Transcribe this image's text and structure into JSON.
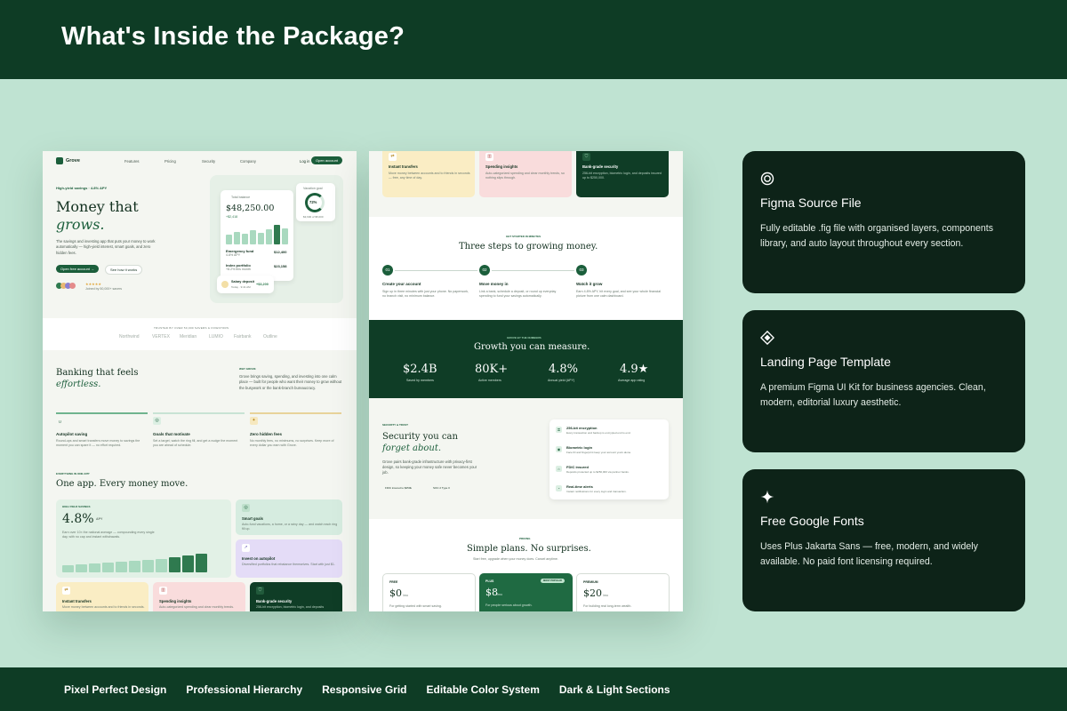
{
  "header": {
    "title": "What's Inside the Package?"
  },
  "footer": {
    "features": [
      "Pixel Perfect Design",
      "Professional Hierarchy",
      "Responsive Grid",
      "Editable Color System",
      "Dark & Light Sections"
    ]
  },
  "cards": [
    {
      "icon": "concentric-circles-icon",
      "title": "Figma Source File",
      "description": "Fully editable .fig file with organised layers, components library, and auto layout throughout every section."
    },
    {
      "icon": "diamond-icon",
      "title": "Landing Page Template",
      "description": "A premium Figma UI Kit for business agencies. Clean, modern, editorial luxury aesthetic."
    },
    {
      "icon": "sparkle-icon",
      "title": "Free Google Fonts",
      "description": "Uses Plus Jakarta Sans — free, modern, and widely available. No paid font licensing required."
    }
  ],
  "preview1": {
    "brand": "Grove",
    "nav": [
      "Features",
      "Pricing",
      "Security",
      "Company"
    ],
    "login": "Log in",
    "open_account": "Open account",
    "badge": "High-yield savings · 4.8% APY",
    "hero_title": "Money that",
    "hero_title_italic": "grows.",
    "hero_body": "The savings and investing app that puts your money to work automatically — high-yield interest, smart goals, and zero hidden fees.",
    "cta_primary": "Open free account →",
    "cta_secondary": "See how it works",
    "stars": "★★★★★",
    "savers": "Joined by 50,000+ savers",
    "balance_label": "Total balance",
    "balance": "$48,250.00",
    "balance_change": "+$2,418",
    "vacation_label": "Vacation goal",
    "vacation_pct": "72%",
    "vacation_amount": "$3,600 of $5,000",
    "accounts": [
      {
        "name": "Emergency fund",
        "sub": "4.8% APY",
        "amount": "$12,400"
      },
      {
        "name": "Index portfolio",
        "sub": "+8.2% this month",
        "amount": "$23,158"
      }
    ],
    "salary_label": "Salary deposit",
    "salary_sub": "Today · 9:41 AM",
    "salary_amount": "+$3,200",
    "trusted_label": "TRUSTED BY OVER 50,000 SAVERS & INVESTORS",
    "trusted": [
      "Northwind",
      "VERTEX",
      "Meridian",
      "LUMIO",
      "Fairbank",
      "Outline"
    ],
    "banking_title": "Banking that feels",
    "banking_italic": "effortless.",
    "why_label": "WHY GROVE",
    "why_body": "Grove brings saving, spending, and investing into one calm place — built for people who want their money to grow without the busywork or the bank-branch bureaucracy.",
    "features": [
      {
        "title": "Autopilot saving",
        "body": "Round-ups and smart transfers move money to savings the moment you can spare it — no effort required."
      },
      {
        "title": "Goals that motivate",
        "body": "Set a target, watch the ring fill, and get a nudge the moment you are ahead of schedule."
      },
      {
        "title": "Zero hidden fees",
        "body": "No monthly fees, no minimums, no surprises. Keep more of every dollar you earn with Grove."
      }
    ],
    "everything_label": "EVERYTHING IN ONE APP",
    "everything_title": "One app. Every money move.",
    "hys_label": "HIGH-YIELD SAVINGS",
    "hys_rate": "4.8%",
    "hys_unit": "APY",
    "hys_body": "Earn over 10× the national average — compounding every single day, with no cap and instant withdrawals.",
    "smart_goals": "Smart goals",
    "smart_goals_body": "Auto-fund vacations, a home, or a rainy day — and watch each ring fill up.",
    "invest": "Invest on autopilot",
    "invest_body": "Diversified portfolios that rebalance themselves. Start with just $1.",
    "instant": "Instant transfers",
    "instant_body": "Move money between accounts and to friends in seconds.",
    "spending": "Spending insights",
    "spending_body": "Auto-categorized spending and clear monthly trends.",
    "bank_security": "Bank-grade security",
    "bank_security_body": "256-bit encryption, biometric login, and deposits"
  },
  "preview2": {
    "instant": "Instant transfers",
    "instant_body": "Move money between accounts and to friends in seconds — free, any time of day.",
    "spending": "Spending insights",
    "spending_body": "Auto-categorized spending and clear monthly trends, so nothing slips through.",
    "bank_security": "Bank-grade security",
    "bank_security_body": "256-bit encryption, biometric login, and deposits insured up to $250,000.",
    "steps_label": "GET STARTED IN MINUTES",
    "steps_title": "Three steps to growing money.",
    "steps": [
      {
        "num": "01",
        "title": "Create your account",
        "body": "Sign up in three minutes with just your phone. No paperwork, no branch visit, no minimum balance."
      },
      {
        "num": "02",
        "title": "Move money in",
        "body": "Link a bank, schedule a deposit, or round up everyday spending to fund your savings automatically."
      },
      {
        "num": "03",
        "title": "Watch it grow",
        "body": "Earn 4.8% APY, hit every goal, and see your whole financial picture from one calm dashboard."
      }
    ],
    "numbers_label": "GROVE BY THE NUMBERS",
    "numbers_title": "Growth you can measure.",
    "stats": [
      {
        "value": "$2.4B",
        "label": "Saved by members"
      },
      {
        "value": "80K+",
        "label": "Active members"
      },
      {
        "value": "4.8%",
        "label": "Annual yield (APY)"
      },
      {
        "value": "4.9★",
        "label": "Average app rating"
      }
    ],
    "security_label": "SECURITY & TRUST",
    "security_title": "Security you can",
    "security_italic": "forget about.",
    "security_body": "Grove pairs bank-grade infrastructure with privacy-first design, so keeping your money safe never becomes your job.",
    "badge_fdic": "FDIC insured to $250k",
    "badge_soc": "SOC 2 Type II",
    "security_items": [
      {
        "title": "256-bit encryption",
        "body": "Every transaction and backup is encrypted end to end."
      },
      {
        "title": "Biometric login",
        "body": "Face ID and fingerprint keep your account yours alone."
      },
      {
        "title": "FDIC insured",
        "body": "Deposits protected up to $250,000 via partner banks."
      },
      {
        "title": "Real-time alerts",
        "body": "Instant notifications for every login and transaction."
      }
    ],
    "pricing_label": "PRICING",
    "pricing_title": "Simple plans. No surprises.",
    "pricing_sub": "Start free, upgrade when your money does. Cancel anytime.",
    "plans": [
      {
        "name": "FREE",
        "price": "$0",
        "per": "/mo",
        "body": "For getting started with smart saving."
      },
      {
        "name": "PLUS",
        "price": "$8",
        "per": "/mo",
        "body": "For people serious about growth.",
        "badge": "MOST POPULAR"
      },
      {
        "name": "PREMIUM",
        "price": "$20",
        "per": "/mo",
        "body": "For building real long-term wealth."
      }
    ]
  }
}
